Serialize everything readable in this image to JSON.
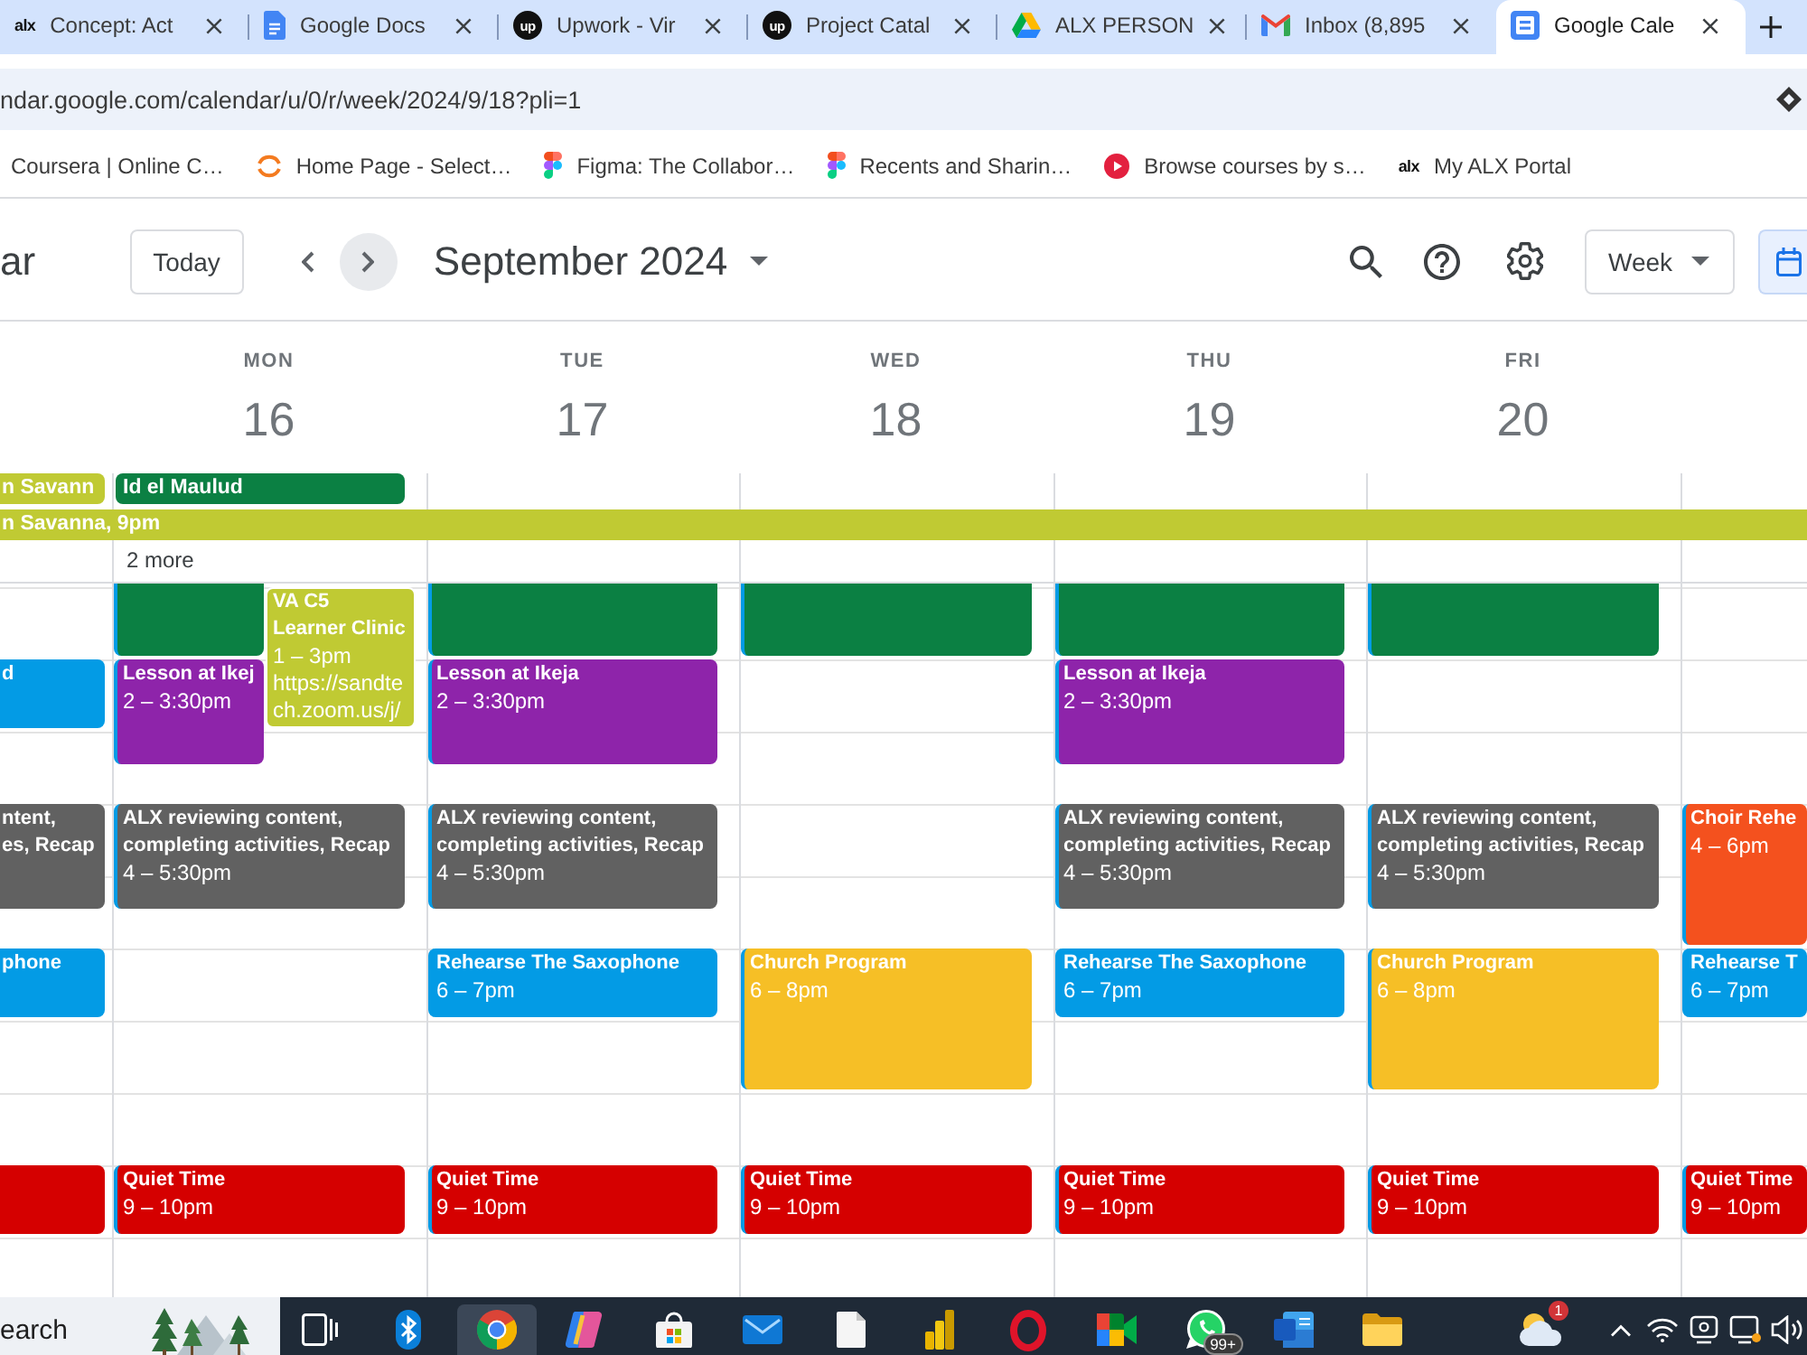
{
  "browser": {
    "tabs": [
      {
        "favicon": {
          "kind": "text-logo",
          "text": "alx"
        },
        "title": "Concept: Act",
        "selected": false
      },
      {
        "favicon": {
          "kind": "document"
        },
        "title": "Google Docs",
        "selected": false
      },
      {
        "favicon": {
          "kind": "circle-logo",
          "text": "up"
        },
        "title": "Upwork - Vir",
        "selected": false
      },
      {
        "favicon": {
          "kind": "circle-logo",
          "text": "up"
        },
        "title": "Project Catal",
        "selected": false
      },
      {
        "favicon": {
          "kind": "triangle"
        },
        "title": "ALX PERSON",
        "selected": false
      },
      {
        "favicon": {
          "kind": "envelope"
        },
        "title": "Inbox (8,895",
        "selected": false
      },
      {
        "favicon": {
          "kind": "calendar"
        },
        "title": "Google Cale",
        "selected": true
      }
    ],
    "address": "ndar.google.com/calendar/u/0/r/week/2024/9/18?pli=1",
    "bookmarks": [
      {
        "title": "Coursera | Online C…"
      },
      {
        "favicon": {
          "kind": "arc"
        },
        "title": "Home Page - Select…"
      },
      {
        "favicon": {
          "kind": "shapes"
        },
        "title": "Figma: The Collabor…"
      },
      {
        "favicon": {
          "kind": "shapes"
        },
        "title": "Recents and Sharin…"
      },
      {
        "favicon": {
          "kind": "play"
        },
        "title": "Browse courses by s…"
      },
      {
        "favicon": {
          "kind": "text-logo",
          "text": "alx"
        },
        "title": "My ALX Portal"
      }
    ]
  },
  "calendar": {
    "header": {
      "app_title": "ar",
      "today": "Today",
      "nav": [
        {
          "kind": "prev",
          "hovered": false
        },
        {
          "kind": "next",
          "hovered": true
        }
      ],
      "month": "September 2024",
      "view": "Week",
      "view_toggle": {
        "selected": true
      }
    },
    "spanning_events": [
      {
        "title": "n Savanna, 9pm",
        "color": "#c0ca33"
      }
    ],
    "days": [
      {
        "all_day": [
          {
            "title": "n Savann",
            "color": "#c0ca33"
          }
        ],
        "events": [
          {
            "color": "#039be5",
            "lines": [
              {
                "kind": "title",
                "text": "d"
              }
            ]
          },
          {
            "color": "#616161",
            "lines": [
              {
                "kind": "title",
                "text": "ntent,"
              },
              {
                "kind": "title",
                "text": "es, Recap"
              }
            ]
          },
          {
            "color": "#039be5",
            "lines": [
              {
                "kind": "title",
                "text": "phone"
              }
            ]
          },
          {
            "color": "#d50000"
          }
        ]
      },
      {
        "name": "MON",
        "date": "16",
        "all_day": [
          {
            "title": "Id el Maulud",
            "color": "#0b8043"
          }
        ],
        "more": "2 more",
        "events": [
          {
            "color": "#0b8043"
          },
          {
            "color": "#8e24aa",
            "lines": [
              {
                "kind": "title",
                "text": "Lesson at Ikej"
              },
              {
                "kind": "time",
                "text": "2 – 3:30pm"
              }
            ]
          },
          {
            "color": "#c0ca33",
            "lines": [
              {
                "kind": "title",
                "text": "VA C5"
              },
              {
                "kind": "title",
                "text": "Learner Clinic"
              },
              {
                "kind": "time",
                "text": "1 – 3pm"
              },
              {
                "kind": "text",
                "text": "https://sandte"
              },
              {
                "kind": "text",
                "text": "ch.zoom.us/j/"
              }
            ]
          },
          {
            "color": "#616161",
            "lines": [
              {
                "kind": "title",
                "text": "ALX reviewing content, completing activities, Recap"
              },
              {
                "kind": "time",
                "text": "4 – 5:30pm"
              }
            ]
          },
          {
            "color": "#d50000",
            "lines": [
              {
                "kind": "title",
                "text": "Quiet Time"
              },
              {
                "kind": "time",
                "text": "9 – 10pm"
              }
            ]
          }
        ]
      },
      {
        "name": "TUE",
        "date": "17",
        "events": [
          {
            "color": "#0b8043"
          },
          {
            "color": "#8e24aa",
            "lines": [
              {
                "kind": "title",
                "text": "Lesson at Ikeja"
              },
              {
                "kind": "time",
                "text": "2 – 3:30pm"
              }
            ]
          },
          {
            "color": "#616161",
            "lines": [
              {
                "kind": "title",
                "text": "ALX reviewing content, completing activities, Recap"
              },
              {
                "kind": "time",
                "text": "4 – 5:30pm"
              }
            ]
          },
          {
            "color": "#039be5",
            "lines": [
              {
                "kind": "title",
                "text": "Rehearse The Saxophone"
              },
              {
                "kind": "time",
                "text": "6 – 7pm"
              }
            ]
          },
          {
            "color": "#d50000",
            "lines": [
              {
                "kind": "title",
                "text": "Quiet Time"
              },
              {
                "kind": "time",
                "text": "9 – 10pm"
              }
            ]
          }
        ]
      },
      {
        "name": "WED",
        "date": "18",
        "events": [
          {
            "color": "#0b8043"
          },
          {
            "color": "#f6bf26",
            "lines": [
              {
                "kind": "title",
                "text": "Church Program"
              },
              {
                "kind": "time",
                "text": "6 – 8pm"
              }
            ]
          },
          {
            "color": "#d50000",
            "lines": [
              {
                "kind": "title",
                "text": "Quiet Time"
              },
              {
                "kind": "time",
                "text": "9 – 10pm"
              }
            ]
          }
        ]
      },
      {
        "name": "THU",
        "date": "19",
        "events": [
          {
            "color": "#0b8043"
          },
          {
            "color": "#8e24aa",
            "lines": [
              {
                "kind": "title",
                "text": "Lesson at Ikeja"
              },
              {
                "kind": "time",
                "text": "2 – 3:30pm"
              }
            ]
          },
          {
            "color": "#616161",
            "lines": [
              {
                "kind": "title",
                "text": "ALX reviewing content, completing activities, Recap"
              },
              {
                "kind": "time",
                "text": "4 – 5:30pm"
              }
            ]
          },
          {
            "color": "#039be5",
            "lines": [
              {
                "kind": "title",
                "text": "Rehearse The Saxophone"
              },
              {
                "kind": "time",
                "text": "6 – 7pm"
              }
            ]
          },
          {
            "color": "#d50000",
            "lines": [
              {
                "kind": "title",
                "text": "Quiet Time"
              },
              {
                "kind": "time",
                "text": "9 – 10pm"
              }
            ]
          }
        ]
      },
      {
        "name": "FRI",
        "date": "20",
        "events": [
          {
            "color": "#0b8043"
          },
          {
            "color": "#616161",
            "lines": [
              {
                "kind": "title",
                "text": "ALX reviewing content, completing activities, Recap"
              },
              {
                "kind": "time",
                "text": "4 – 5:30pm"
              }
            ]
          },
          {
            "color": "#f6bf26",
            "lines": [
              {
                "kind": "title",
                "text": "Church Program"
              },
              {
                "kind": "time",
                "text": "6 – 8pm"
              }
            ]
          },
          {
            "color": "#d50000",
            "lines": [
              {
                "kind": "title",
                "text": "Quiet Time"
              },
              {
                "kind": "time",
                "text": "9 – 10pm"
              }
            ]
          }
        ]
      },
      {
        "events": [
          {
            "color": "#f4511e",
            "lines": [
              {
                "kind": "title",
                "text": "Choir Rehe"
              },
              {
                "kind": "time",
                "text": "4 – 6pm"
              }
            ]
          },
          {
            "color": "#039be5",
            "lines": [
              {
                "kind": "title",
                "text": "Rehearse T"
              },
              {
                "kind": "time",
                "text": "6 – 7pm"
              }
            ]
          },
          {
            "color": "#d50000",
            "lines": [
              {
                "kind": "title",
                "text": "Quiet Time"
              },
              {
                "kind": "time",
                "text": "9 – 10pm"
              }
            ]
          }
        ]
      }
    ]
  },
  "taskbar": {
    "search": {
      "placeholder": "earch"
    },
    "apps": [
      {
        "kind": "task-view",
        "active": false
      },
      {
        "kind": "bluetooth",
        "active": false
      },
      {
        "kind": "browser",
        "active": true
      },
      {
        "kind": "assistant",
        "active": false
      },
      {
        "kind": "store",
        "active": false
      },
      {
        "kind": "mail",
        "active": false
      },
      {
        "kind": "file",
        "active": false
      },
      {
        "kind": "chart",
        "active": false
      },
      {
        "kind": "ring",
        "active": false
      },
      {
        "kind": "video",
        "active": false
      },
      {
        "kind": "chat",
        "active": false,
        "badge": "99+"
      },
      {
        "kind": "word",
        "active": false
      },
      {
        "kind": "folder",
        "active": false
      }
    ],
    "tray": [
      {
        "kind": "weather",
        "badge": "1"
      },
      {
        "kind": "chevron"
      },
      {
        "kind": "wifi"
      },
      {
        "kind": "camera"
      },
      {
        "kind": "display"
      },
      {
        "kind": "speaker"
      }
    ]
  }
}
